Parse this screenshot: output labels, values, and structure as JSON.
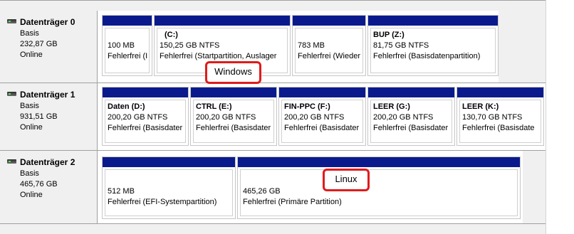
{
  "disks": [
    {
      "name": "Datenträger 0",
      "type": "Basis",
      "size": "232,87 GB",
      "status": "Online",
      "partitions": [
        {
          "label": "",
          "size": "100 MB",
          "status": "Fehlerfrei (I"
        },
        {
          "label": "(C:)",
          "size": "150,25 GB NTFS",
          "status": "Fehlerfrei (Startpartition, Auslager"
        },
        {
          "label": "",
          "size": "783 MB",
          "status": "Fehlerfrei (Wieder"
        },
        {
          "label": "BUP  (Z:)",
          "size": "81,75 GB NTFS",
          "status": "Fehlerfrei (Basisdatenpartition)"
        }
      ]
    },
    {
      "name": "Datenträger 1",
      "type": "Basis",
      "size": "931,51 GB",
      "status": "Online",
      "partitions": [
        {
          "label": "Daten  (D:)",
          "size": "200,20 GB NTFS",
          "status": "Fehlerfrei (Basisdater"
        },
        {
          "label": "CTRL  (E:)",
          "size": "200,20 GB NTFS",
          "status": "Fehlerfrei (Basisdater"
        },
        {
          "label": "FIN-PPC  (F:)",
          "size": "200,20 GB NTFS",
          "status": "Fehlerfrei (Basisdater"
        },
        {
          "label": "LEER  (G:)",
          "size": "200,20 GB NTFS",
          "status": "Fehlerfrei (Basisdater"
        },
        {
          "label": "LEER  (K:)",
          "size": "130,70 GB NTFS",
          "status": "Fehlerfrei (Basisdate"
        }
      ]
    },
    {
      "name": "Datenträger 2",
      "type": "Basis",
      "size": "465,76 GB",
      "status": "Online",
      "partitions": [
        {
          "label": "",
          "size": "512 MB",
          "status": "Fehlerfrei (EFI-Systempartition)"
        },
        {
          "label": "",
          "size": "465,26 GB",
          "status": "Fehlerfrei (Primäre Partition)"
        }
      ]
    }
  ],
  "annotations": {
    "windows": "Windows",
    "linux": "Linux",
    "color": "#e01b1b"
  },
  "colors": {
    "partition_bar": "#0a1a8c",
    "background": "#f0f0f0"
  }
}
